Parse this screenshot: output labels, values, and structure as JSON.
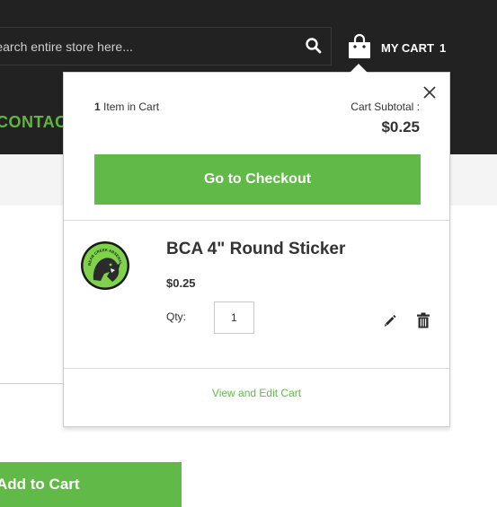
{
  "header": {
    "search": {
      "placeholder": "Search entire store here..."
    },
    "cart": {
      "label": "MY CART",
      "count": "1"
    },
    "nav": {
      "contact_label": "CONTACT US"
    }
  },
  "minicart": {
    "items_count": "1",
    "items_label": "Item in Cart",
    "subtotal_label": "Cart Subtotal :",
    "subtotal_value": "$0.25",
    "checkout_label": "Go to Checkout",
    "item": {
      "name": "BCA 4\" Round Sticker",
      "price": "$0.25",
      "qty_label": "Qty:",
      "qty_value": "1",
      "image_text": "BEAR CREEK ARSENAL"
    },
    "view_edit_label": "View and Edit Cart"
  },
  "page": {
    "add_to_cart_label": "Add to Cart"
  },
  "colors": {
    "accent": "#61b947",
    "header_bg": "#222222"
  }
}
